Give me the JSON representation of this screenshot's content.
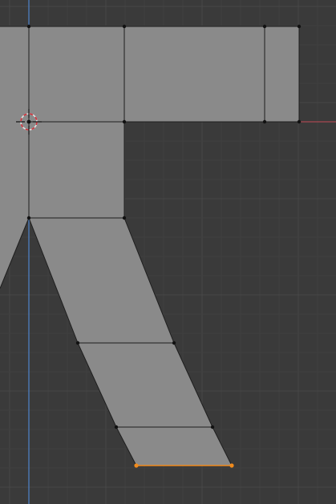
{
  "viewport": {
    "view": "3d-viewport-edit-mode",
    "background_color": "#3a3a3a",
    "grid_minor_color": "#404040",
    "grid_major_color": "#474747",
    "axis_x_color": "#c24a55",
    "axis_y_color": "#4d7ec2"
  },
  "mesh": {
    "face_color": "#8a8a8a",
    "edge_color": "#1e1e1e",
    "vertex_color": "#111111",
    "selected_color": "#f08a1c",
    "selected_edge_count": 1,
    "selected_vertex_count": 2
  },
  "cursor": {
    "icon": "3d-cursor-icon",
    "ring_color_a": "#e0e0e0",
    "ring_color_b": "#d0303a"
  }
}
